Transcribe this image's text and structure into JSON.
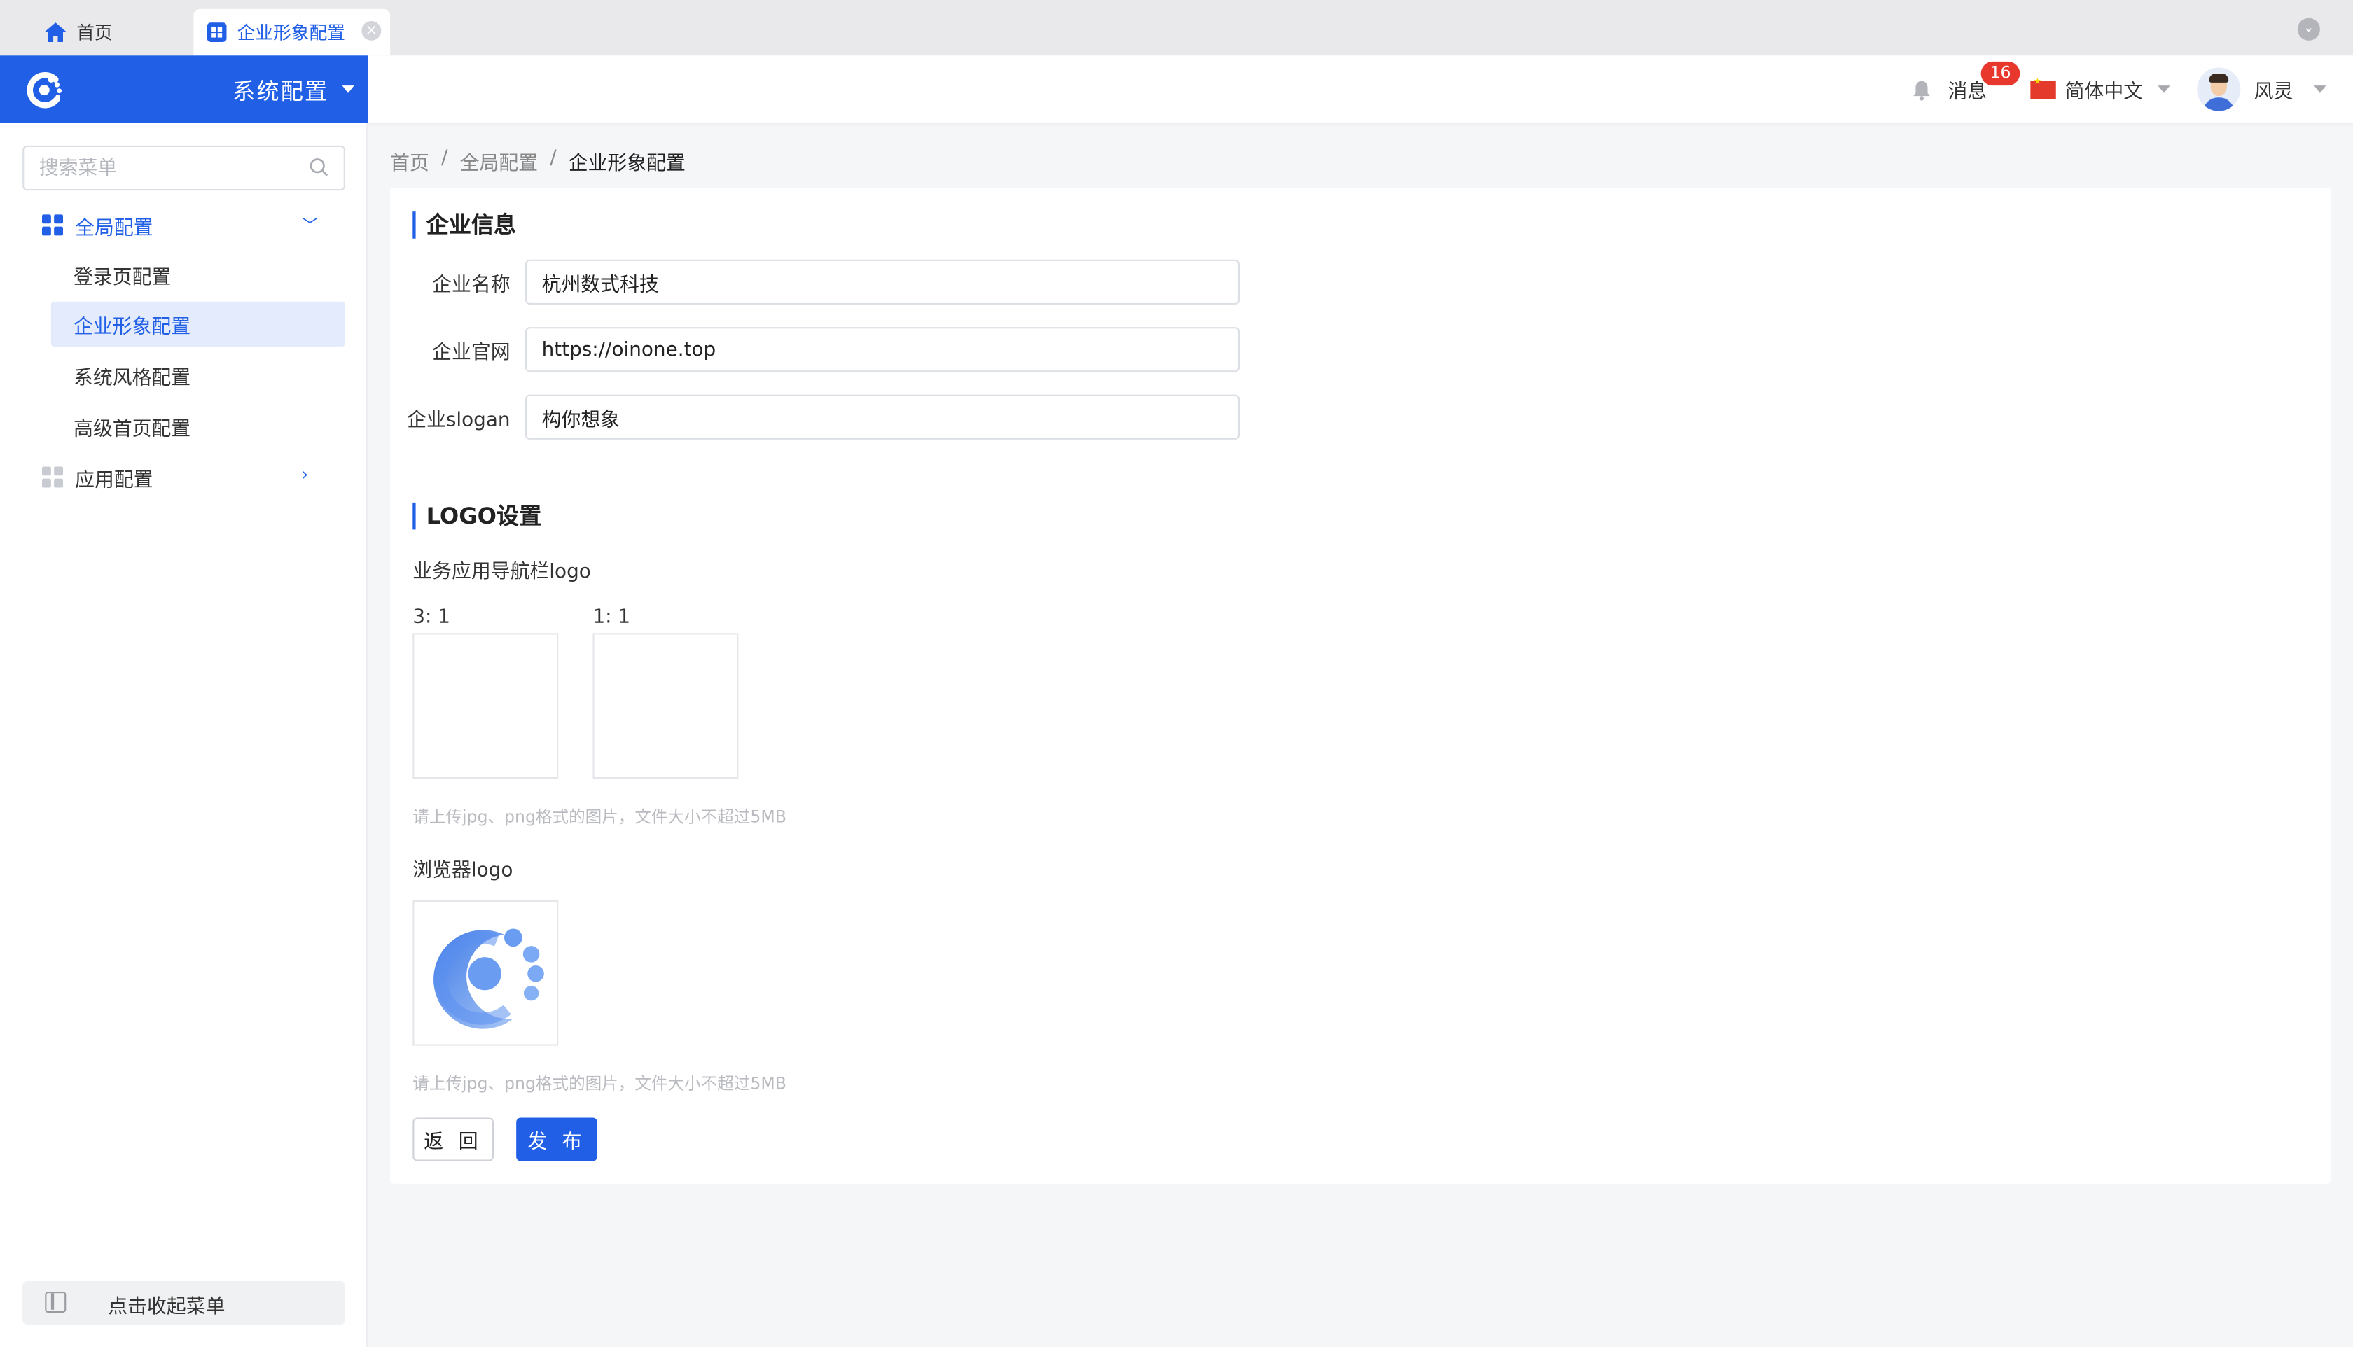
{
  "tabs": [
    {
      "label": "首页",
      "icon": "home-icon"
    },
    {
      "label": "企业形象配置",
      "icon": "grid-icon",
      "active": true
    }
  ],
  "header": {
    "app_title": "系统配置",
    "messages_label": "消息",
    "messages_count": "16",
    "language": "简体中文",
    "user_name": "风灵"
  },
  "sidebar": {
    "search_placeholder": "搜索菜单",
    "groups": [
      {
        "label": "全局配置",
        "expanded": true,
        "items": [
          {
            "label": "登录页配置"
          },
          {
            "label": "企业形象配置",
            "active": true
          },
          {
            "label": "系统风格配置"
          },
          {
            "label": "高级首页配置"
          }
        ]
      },
      {
        "label": "应用配置",
        "expanded": false
      }
    ],
    "collapse_label": "点击收起菜单"
  },
  "breadcrumb": [
    "首页",
    "全局配置",
    "企业形象配置"
  ],
  "form": {
    "section_company": "企业信息",
    "fields": [
      {
        "label": "企业名称",
        "value": "杭州数式科技"
      },
      {
        "label": "企业官网",
        "value": "https://oinone.top"
      },
      {
        "label": "企业slogan",
        "value": "构你想象"
      }
    ],
    "section_logo": "LOGO设置",
    "nav_logo_label": "业务应用导航栏logo",
    "ratio_3_1": "3: 1",
    "ratio_1_1": "1: 1",
    "upload_hint": "请上传jpg、png格式的图片，文件大小不超过5MB",
    "browser_logo_label": "浏览器logo",
    "upload_hint_2": "请上传jpg、png格式的图片，文件大小不超过5MB"
  },
  "buttons": {
    "back": "返 回",
    "publish": "发 布"
  },
  "colors": {
    "primary": "#2160e6",
    "badge": "#e8382d"
  }
}
